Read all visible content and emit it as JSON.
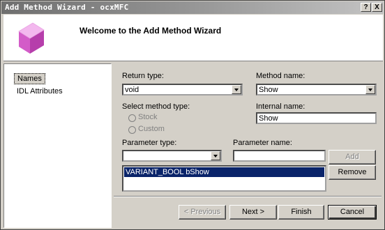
{
  "window": {
    "title": "Add Method Wizard - ocxMFC",
    "help_label": "?",
    "close_label": "X"
  },
  "header": {
    "title": "Welcome to the Add Method Wizard"
  },
  "nav": {
    "items": [
      {
        "label": "Names",
        "selected": true
      },
      {
        "label": "IDL Attributes",
        "selected": false
      }
    ]
  },
  "form": {
    "return_type": {
      "label": "Return type:",
      "value": "void"
    },
    "method_name": {
      "label": "Method name:",
      "value": "Show"
    },
    "select_method_type": {
      "label": "Select method type:",
      "options": [
        "Stock",
        "Custom"
      ]
    },
    "internal_name": {
      "label": "Internal name:",
      "value": "Show"
    },
    "parameter_type": {
      "label": "Parameter type:",
      "value": ""
    },
    "parameter_name": {
      "label": "Parameter name:",
      "value": ""
    },
    "add_label": "Add",
    "remove_label": "Remove",
    "parameters": [
      "VARIANT_BOOL bShow"
    ]
  },
  "footer": {
    "previous_label": "< Previous",
    "next_label": "Next >",
    "finish_label": "Finish",
    "cancel_label": "Cancel"
  },
  "colors": {
    "selection": "#0a246a",
    "face": "#d4d0c8",
    "logo": "#d35cc8"
  }
}
